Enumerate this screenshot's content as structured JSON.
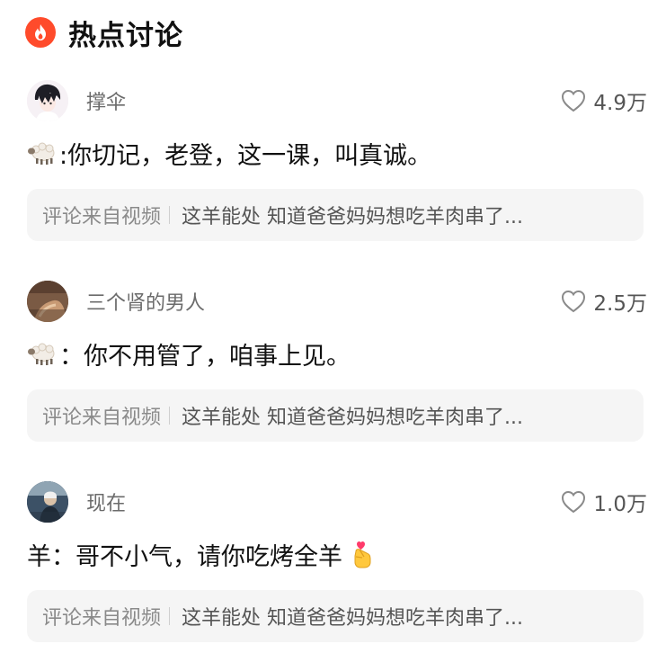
{
  "section": {
    "icon": "flame-icon",
    "title": "热点讨论",
    "accent_color": "#ff4b2b"
  },
  "comments": [
    {
      "username": "撑伞",
      "avatar": "avatar-anime-boy",
      "likes": "4.9万",
      "text_lead_icon": "sheep-icon",
      "text": ":你切记，老登，这一课，叫真诚。",
      "text_trail_icon": "",
      "source_label": "评论来自视频",
      "source_title": "这羊能处 知道爸爸妈妈想吃羊肉串了..."
    },
    {
      "username": "三个肾的男人",
      "avatar": "avatar-brown-photo",
      "likes": "2.5万",
      "text_lead_icon": "sheep-icon",
      "text": "：你不用管了，咱事上见。",
      "text_trail_icon": "",
      "source_label": "评论来自视频",
      "source_title": "这羊能处 知道爸爸妈妈想吃羊肉串了..."
    },
    {
      "username": "现在",
      "avatar": "avatar-person-photo",
      "likes": "1.0万",
      "text_lead_icon": "",
      "text": "羊：哥不小气，请你吃烤全羊",
      "text_trail_icon": "finger-heart-icon",
      "source_label": "评论来自视频",
      "source_title": "这羊能处 知道爸爸妈妈想吃羊肉串了..."
    }
  ]
}
